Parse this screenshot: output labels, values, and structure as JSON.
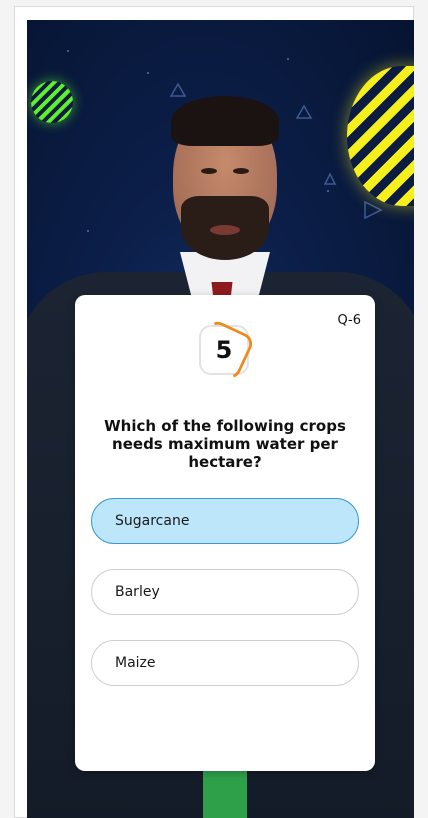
{
  "quiz": {
    "question_number": "Q-6",
    "timer_value": "5",
    "question": "Which of the following crops needs maximum water per hectare?",
    "options": [
      {
        "label": "Sugarcane",
        "selected": true
      },
      {
        "label": "Barley",
        "selected": false
      },
      {
        "label": "Maize",
        "selected": false
      }
    ]
  },
  "colors": {
    "selected_option_bg": "#bde6fb",
    "selected_option_border": "#3a99cf",
    "timer_accent": "#f08a1c",
    "background": "#0c1f4a"
  }
}
